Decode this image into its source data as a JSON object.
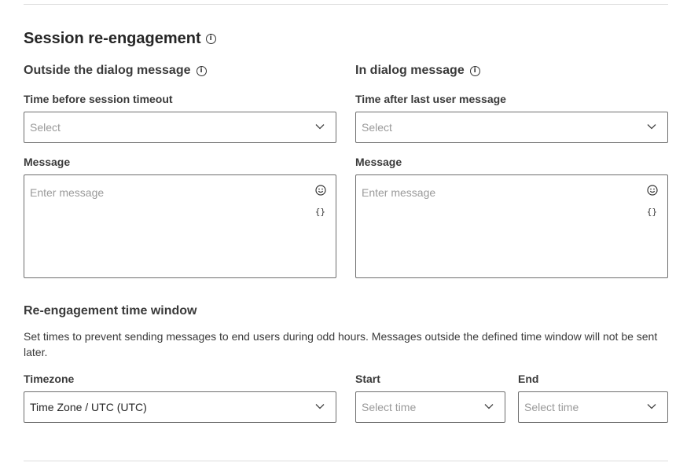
{
  "section": {
    "title": "Session re-engagement"
  },
  "outside": {
    "title": "Outside the dialog message",
    "time_label": "Time before session timeout",
    "time_placeholder": "Select",
    "message_label": "Message",
    "message_placeholder": "Enter message",
    "variable_glyph": "{}"
  },
  "inside": {
    "title": "In dialog message",
    "time_label": "Time after last user message",
    "time_placeholder": "Select",
    "message_label": "Message",
    "message_placeholder": "Enter message",
    "variable_glyph": "{}"
  },
  "window": {
    "title": "Re-engagement time window",
    "description": "Set times to prevent sending messages to end users during odd hours. Messages outside the defined time window will not be sent later.",
    "timezone_label": "Timezone",
    "timezone_value": "Time Zone / UTC (UTC)",
    "start_label": "Start",
    "start_placeholder": "Select time",
    "end_label": "End",
    "end_placeholder": "Select time"
  },
  "icons": {
    "info": "info-icon",
    "chevron": "chevron-down-icon",
    "emoji": "emoji-icon",
    "variable": "variable-braces-icon"
  }
}
